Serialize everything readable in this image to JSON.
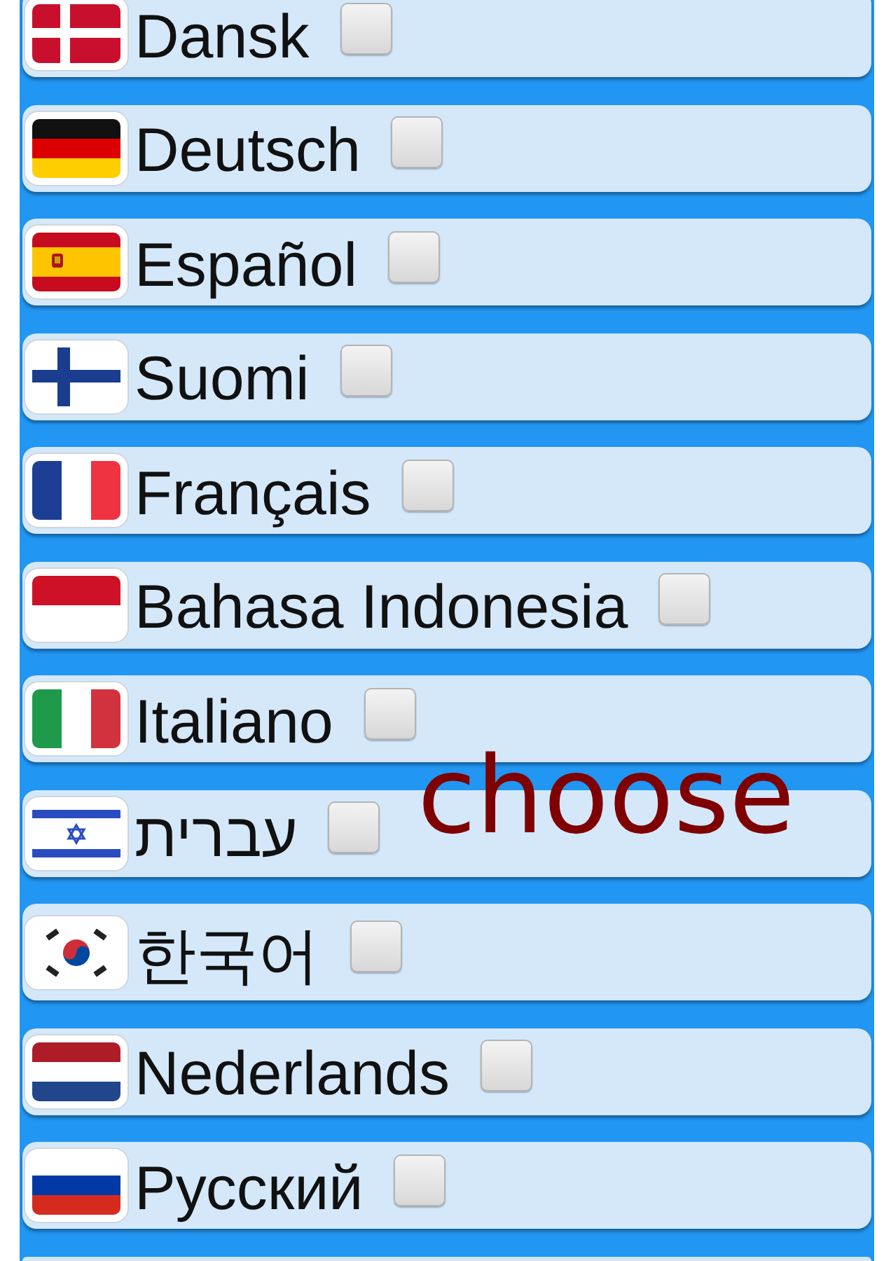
{
  "languages": [
    {
      "name": "Dansk",
      "checked": false
    },
    {
      "name": "Deutsch",
      "checked": false
    },
    {
      "name": "Español",
      "checked": false
    },
    {
      "name": "Suomi",
      "checked": false
    },
    {
      "name": "Français",
      "checked": false
    },
    {
      "name": "Bahasa Indonesia",
      "checked": false
    },
    {
      "name": "Italiano",
      "checked": false
    },
    {
      "name": "עברית",
      "checked": false
    },
    {
      "name": "한국어",
      "checked": false
    },
    {
      "name": "Nederlands",
      "checked": false
    },
    {
      "name": "Русский",
      "checked": false
    }
  ],
  "overlay_text": "choose"
}
